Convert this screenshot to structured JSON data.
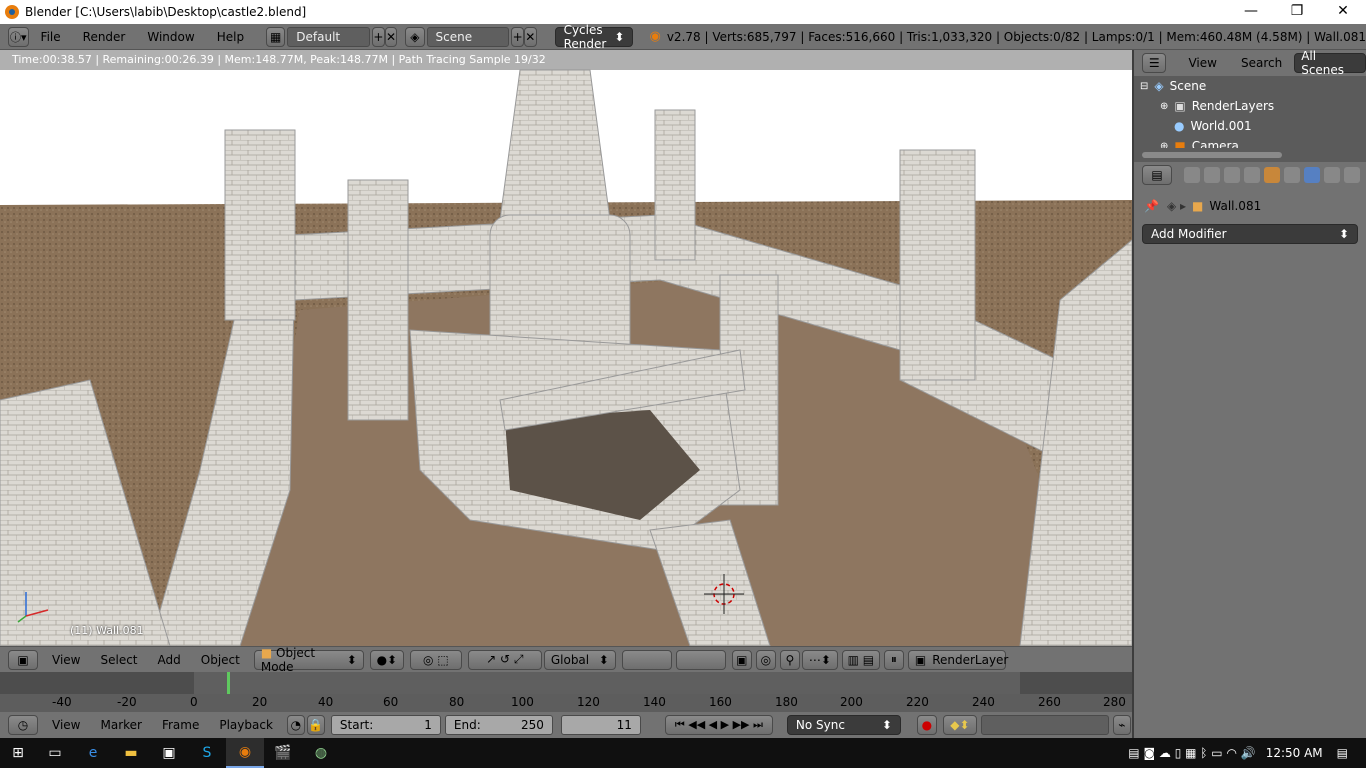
{
  "window": {
    "title": "Blender [C:\\Users\\labib\\Desktop\\castle2.blend]",
    "minimize": "—",
    "maximize": "❐",
    "close": "✕"
  },
  "header": {
    "menus": [
      "File",
      "Render",
      "Window",
      "Help"
    ],
    "screen_layout": "Default",
    "scene": "Scene",
    "render_engine": "Cycles Render",
    "stats": "v2.78 | Verts:685,797 | Faces:516,660 | Tris:1,033,320 | Objects:0/82 | Lamps:0/1 | Mem:460.48M (4.58M) | Wall.081"
  },
  "viewport": {
    "render_status": "Time:00:38.57 | Remaining:00:26.39 | Mem:148.77M, Peak:148.77M | Path Tracing Sample 19/32",
    "object_label": "(11) Wall.081",
    "colors": {
      "sky": "#ffffff",
      "ground": "#8b7258",
      "stone": "#d9d6d0"
    }
  },
  "outliner": {
    "menus": [
      "View",
      "Search"
    ],
    "filter": "All Scenes",
    "items": [
      {
        "label": "Scene",
        "icon": "scene-icon"
      },
      {
        "label": "RenderLayers",
        "icon": "renderlayers-icon"
      },
      {
        "label": "World.001",
        "icon": "world-icon"
      },
      {
        "label": "Camera",
        "icon": "camera-icon"
      }
    ]
  },
  "properties": {
    "object_name": "Wall.081",
    "add_modifier": "Add Modifier"
  },
  "view3d_header": {
    "menus": [
      "View",
      "Select",
      "Add",
      "Object"
    ],
    "mode": "Object Mode",
    "orientation": "Global",
    "render_layer": "RenderLayer"
  },
  "timeline": {
    "ticks": [
      "-40",
      "-20",
      "0",
      "20",
      "40",
      "60",
      "80",
      "100",
      "120",
      "140",
      "160",
      "180",
      "200",
      "220",
      "240",
      "260",
      "280"
    ],
    "current_frame_marker": 11
  },
  "timeline_header": {
    "menus": [
      "View",
      "Marker",
      "Frame",
      "Playback"
    ],
    "start_label": "Start:",
    "start_value": "1",
    "end_label": "End:",
    "end_value": "250",
    "current_frame": "11",
    "sync": "No Sync"
  },
  "taskbar": {
    "time": "12:50 AM"
  }
}
